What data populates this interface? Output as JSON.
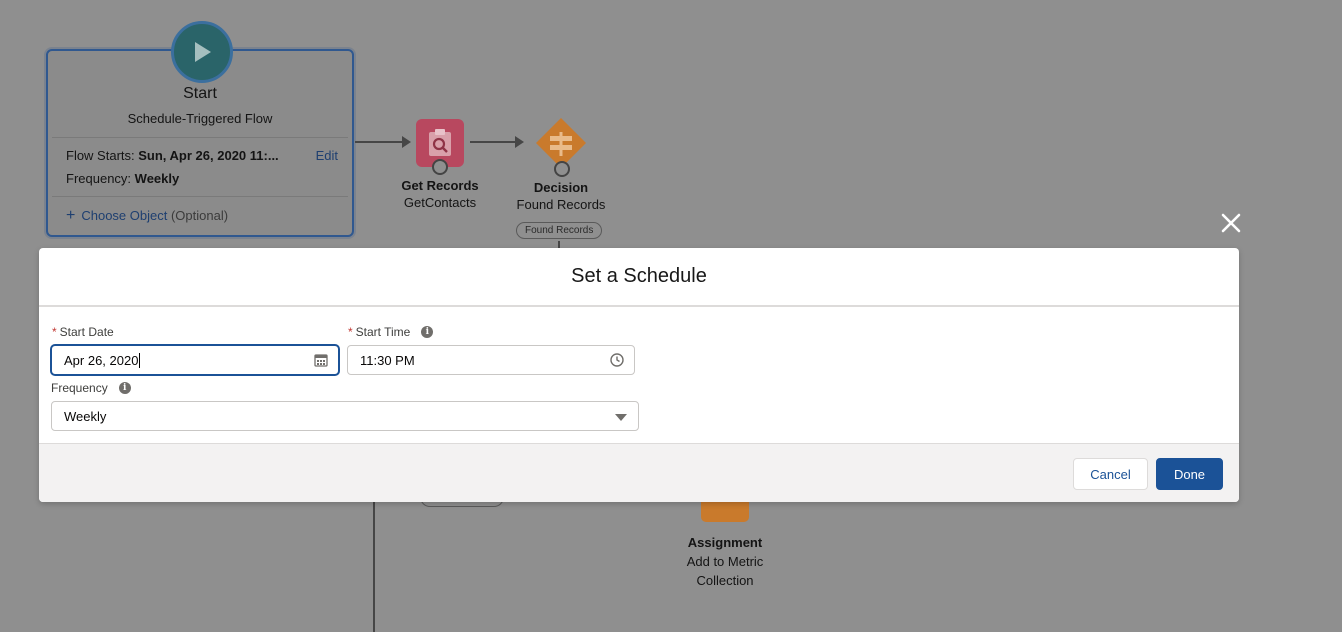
{
  "start_node": {
    "title": "Start",
    "subtitle": "Schedule-Triggered Flow",
    "flow_starts_label": "Flow Starts:",
    "flow_starts_value": "Sun, Apr 26, 2020 11:...",
    "edit_label": "Edit",
    "frequency_label": "Frequency:",
    "frequency_value": "Weekly",
    "choose_object_label": "Choose Object",
    "choose_object_optional": "(Optional)"
  },
  "nodes": {
    "get_records": {
      "type": "Get Records",
      "name": "GetContacts"
    },
    "decision": {
      "type": "Decision",
      "name": "Found Records",
      "outcome_pill": "Found Records"
    },
    "assignment": {
      "type": "Assignment",
      "name_line1": "Add to Metric",
      "name_line2": "Collection"
    }
  },
  "modal": {
    "title": "Set a Schedule",
    "start_date": {
      "label": "Start Date",
      "value": "Apr 26, 2020"
    },
    "start_time": {
      "label": "Start Time",
      "value": "11:30 PM"
    },
    "frequency": {
      "label": "Frequency",
      "value": "Weekly"
    },
    "cancel_label": "Cancel",
    "done_label": "Done"
  },
  "colors": {
    "brand_blue": "#1b5297",
    "get_records_pink": "#b8485f",
    "decision_orange": "#c97a2c",
    "start_teal": "#2a6469"
  }
}
